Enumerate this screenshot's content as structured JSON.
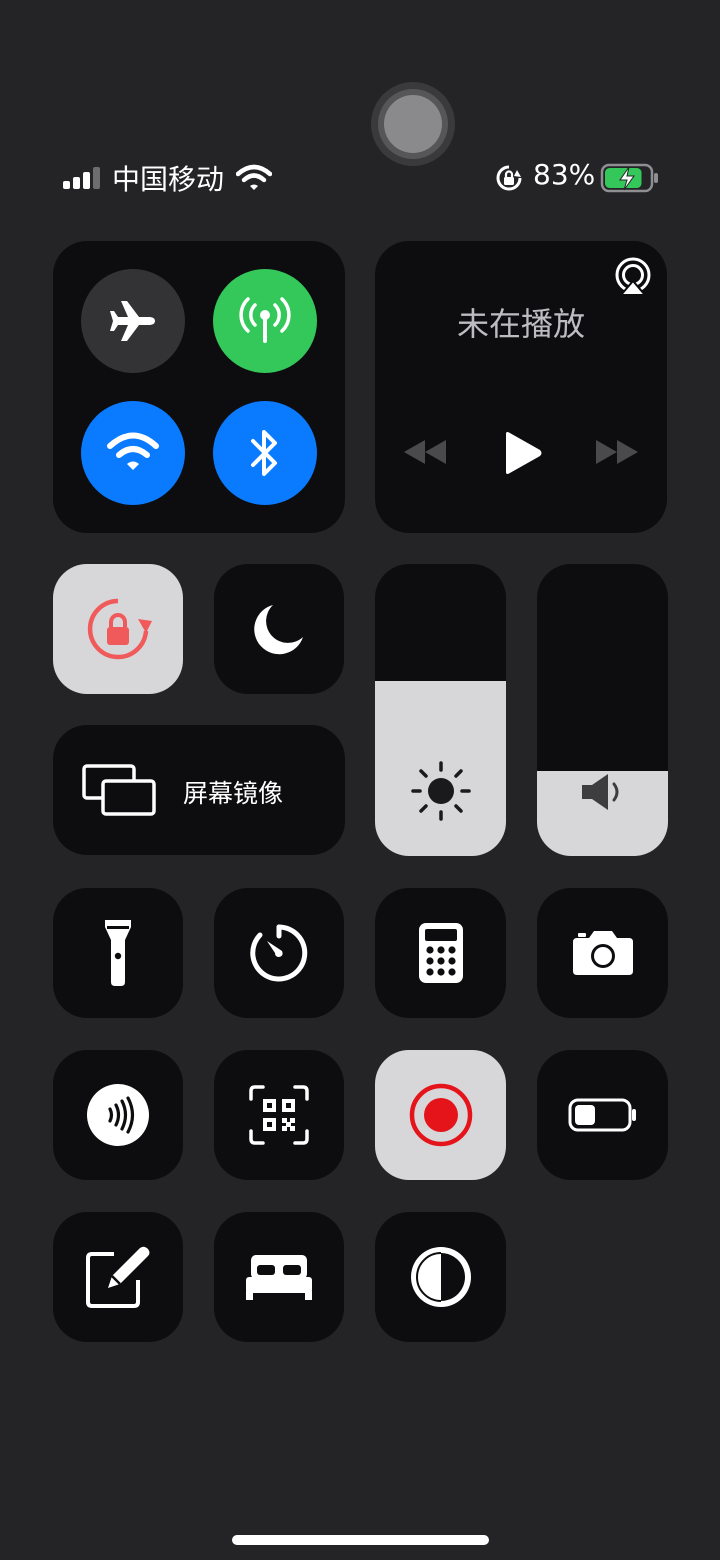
{
  "status_bar": {
    "carrier": "中国移动",
    "battery_percent": "83%",
    "battery_level": 0.83,
    "signal_bars": 3
  },
  "connectivity": {
    "airplane": {
      "enabled": false
    },
    "cellular": {
      "enabled": true
    },
    "wifi": {
      "enabled": true
    },
    "bluetooth": {
      "enabled": true
    }
  },
  "now_playing": {
    "status_text": "未在播放"
  },
  "screen_mirroring": {
    "label": "屏幕镜像"
  },
  "brightness": {
    "level": 0.6
  },
  "volume": {
    "level": 0.29
  },
  "colors": {
    "green": "#34c759",
    "blue": "#0a7aff",
    "tile_dark": "#0d0d0f",
    "tile_light": "#d7d7da",
    "lock_red": "#f05a5a",
    "record_red": "#e5141a"
  },
  "icons": [
    "airplane-icon",
    "cellular-antenna-icon",
    "wifi-icon",
    "bluetooth-icon",
    "airplay-icon",
    "rewind-icon",
    "play-icon",
    "fast-forward-icon",
    "rotation-lock-icon",
    "moon-icon",
    "screen-mirroring-icon",
    "sun-icon",
    "speaker-icon",
    "flashlight-icon",
    "timer-icon",
    "calculator-icon",
    "camera-icon",
    "nfc-icon",
    "qr-scanner-icon",
    "record-icon",
    "low-power-battery-icon",
    "notes-icon",
    "bed-icon",
    "dark-mode-icon"
  ]
}
